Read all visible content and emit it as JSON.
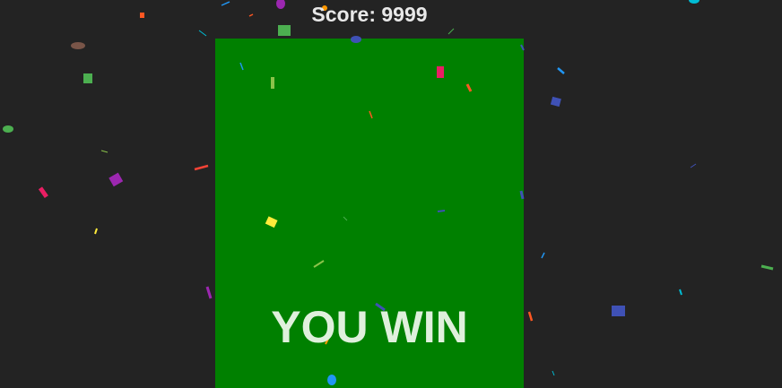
{
  "hud": {
    "score_label": "Score: 9999"
  },
  "game": {
    "result_text": "YOU WIN",
    "board_color": "#008000",
    "background_color": "#232323"
  },
  "confetti_colors": [
    "#e91e63",
    "#ff5722",
    "#4caf50",
    "#3f51b5",
    "#9c27b0",
    "#ffeb3b",
    "#2196f3",
    "#8bc34a",
    "#795548",
    "#00bcd4"
  ]
}
